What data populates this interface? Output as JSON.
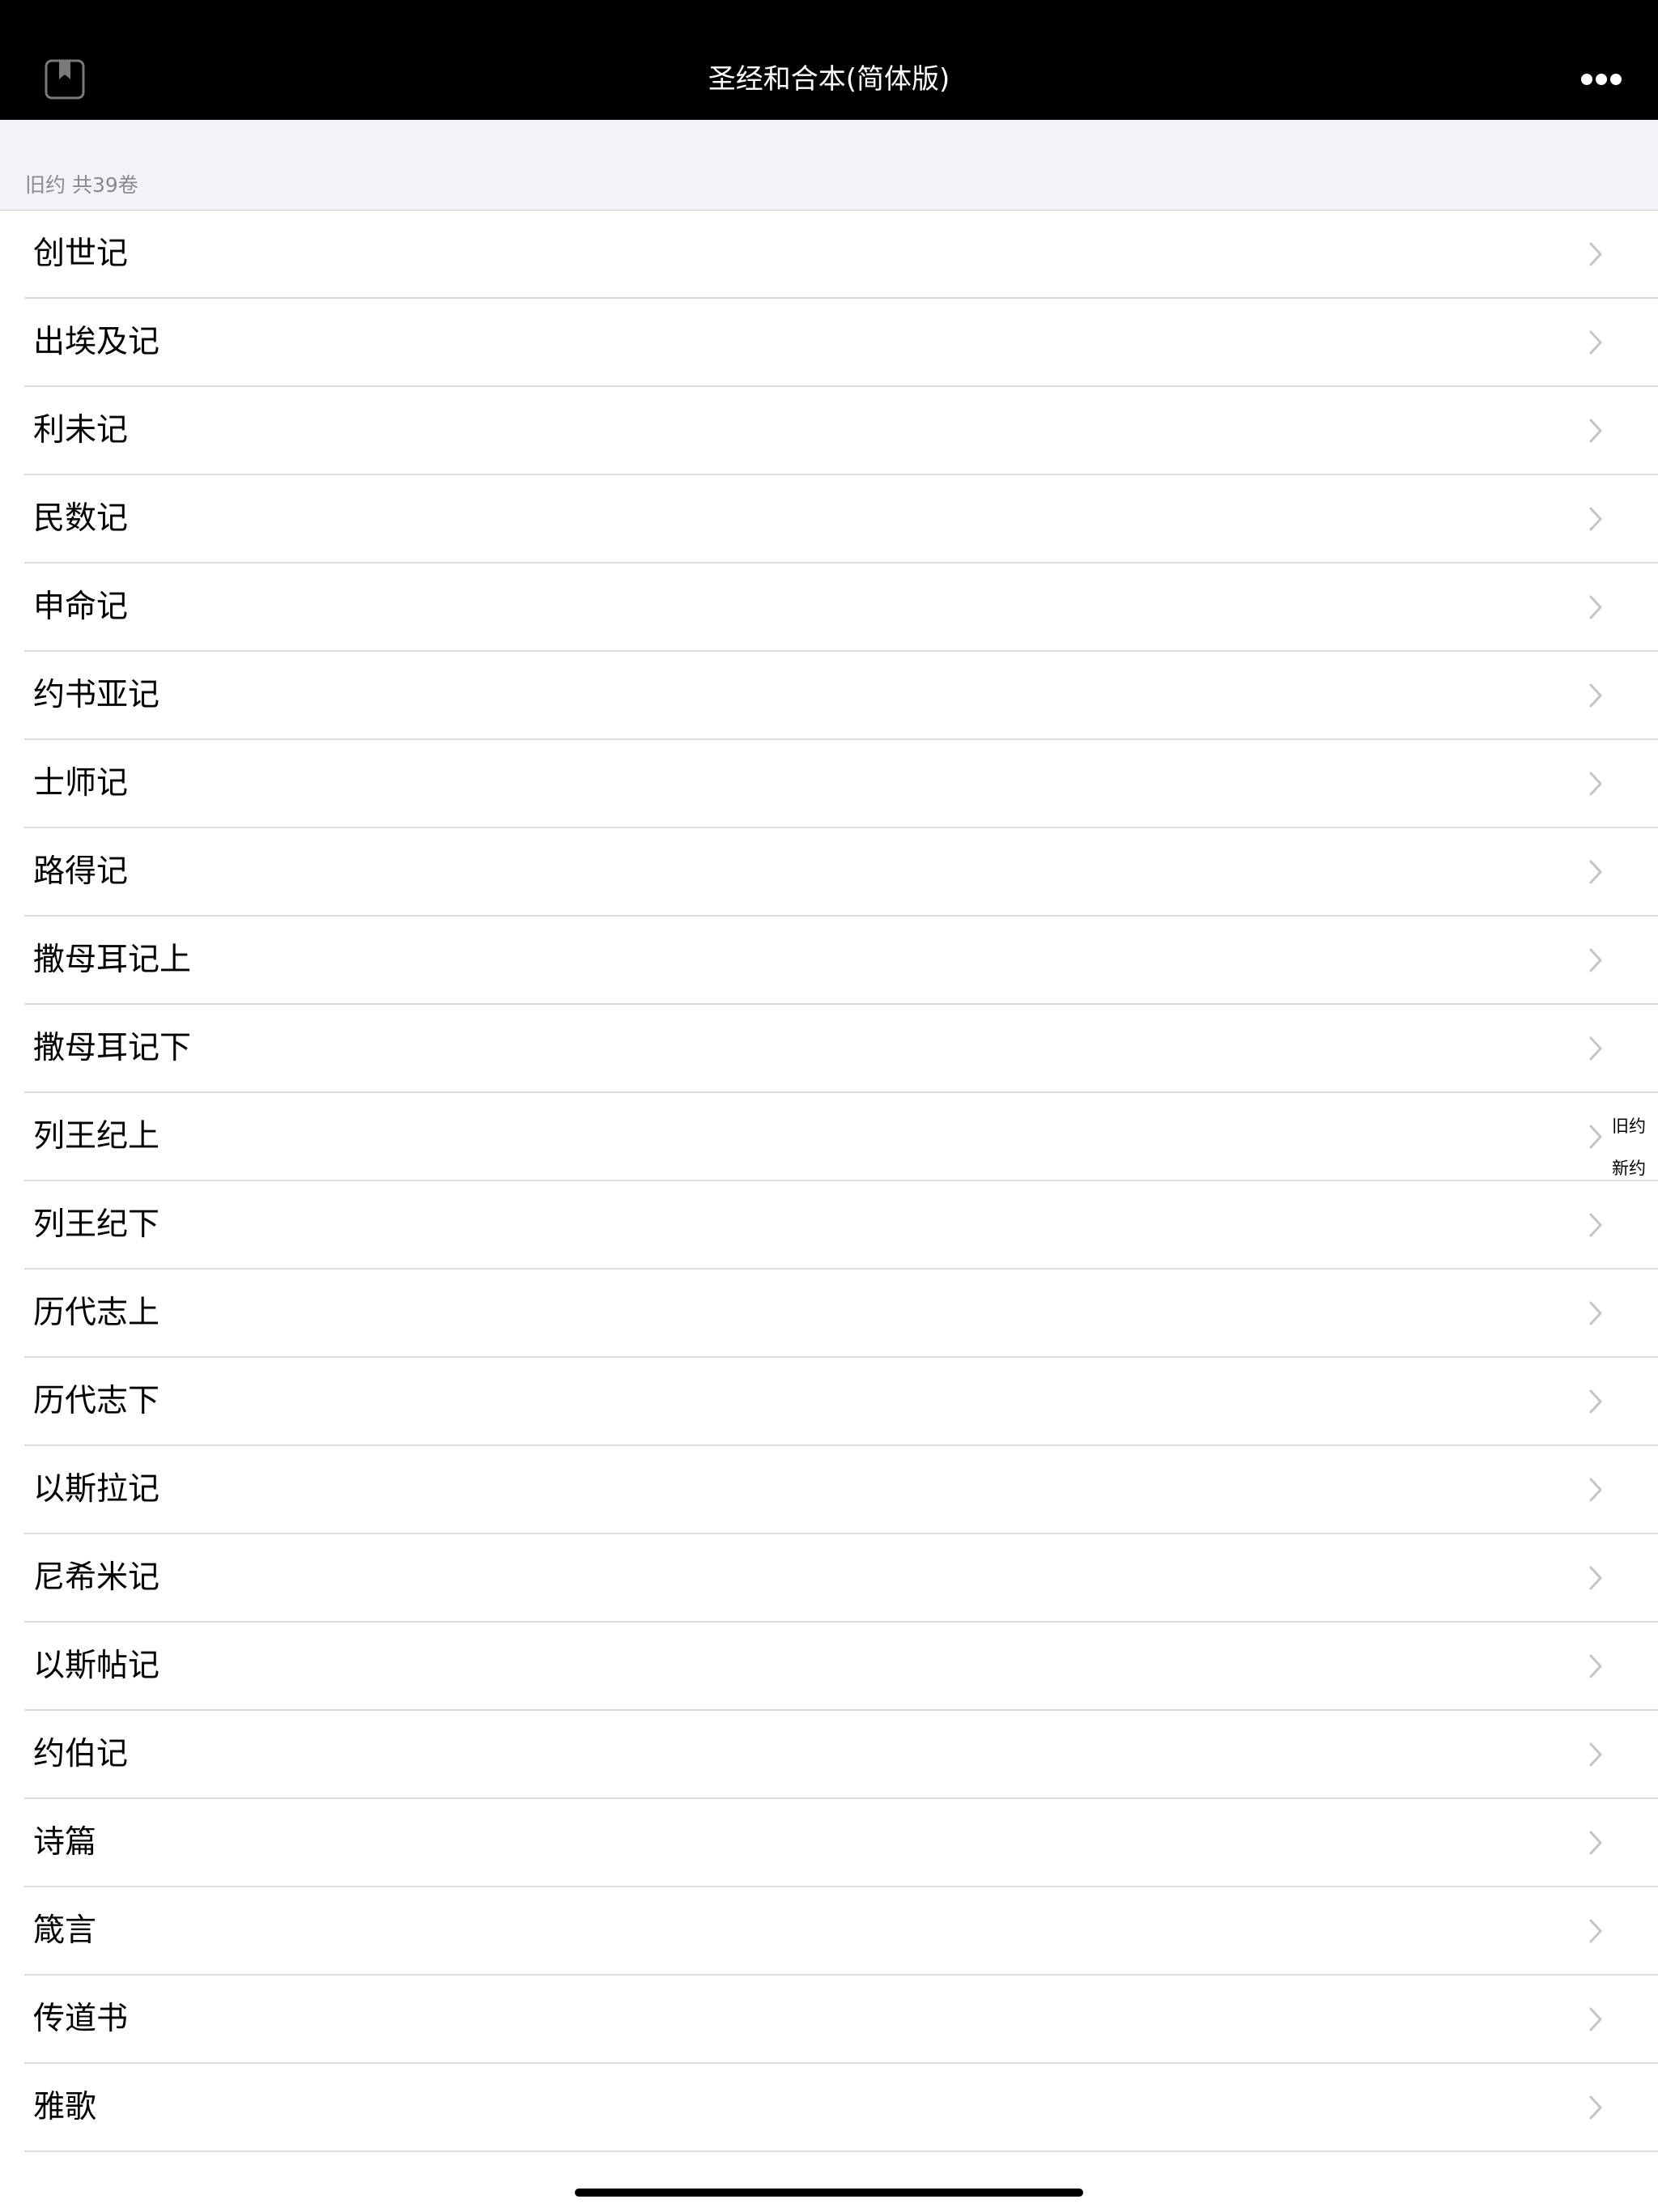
{
  "navbar": {
    "title": "圣经和合本(简体版)",
    "left_icon": "bookmark-icon",
    "right_icon": "more-icon"
  },
  "section": {
    "header": "旧约 共39卷"
  },
  "books": [
    "创世记",
    "出埃及记",
    "利未记",
    "民数记",
    "申命记",
    "约书亚记",
    "士师记",
    "路得记",
    "撒母耳记上",
    "撒母耳记下",
    "列王纪上",
    "列王纪下",
    "历代志上",
    "历代志下",
    "以斯拉记",
    "尼希米记",
    "以斯帖记",
    "约伯记",
    "诗篇",
    "箴言",
    "传道书",
    "雅歌"
  ],
  "index": [
    "旧约",
    "新约"
  ],
  "colors": {
    "navbar_bg": "#000000",
    "section_bg": "#f2f2f7",
    "separator": "#dcdcde",
    "chevron": "#c4c4c7"
  }
}
